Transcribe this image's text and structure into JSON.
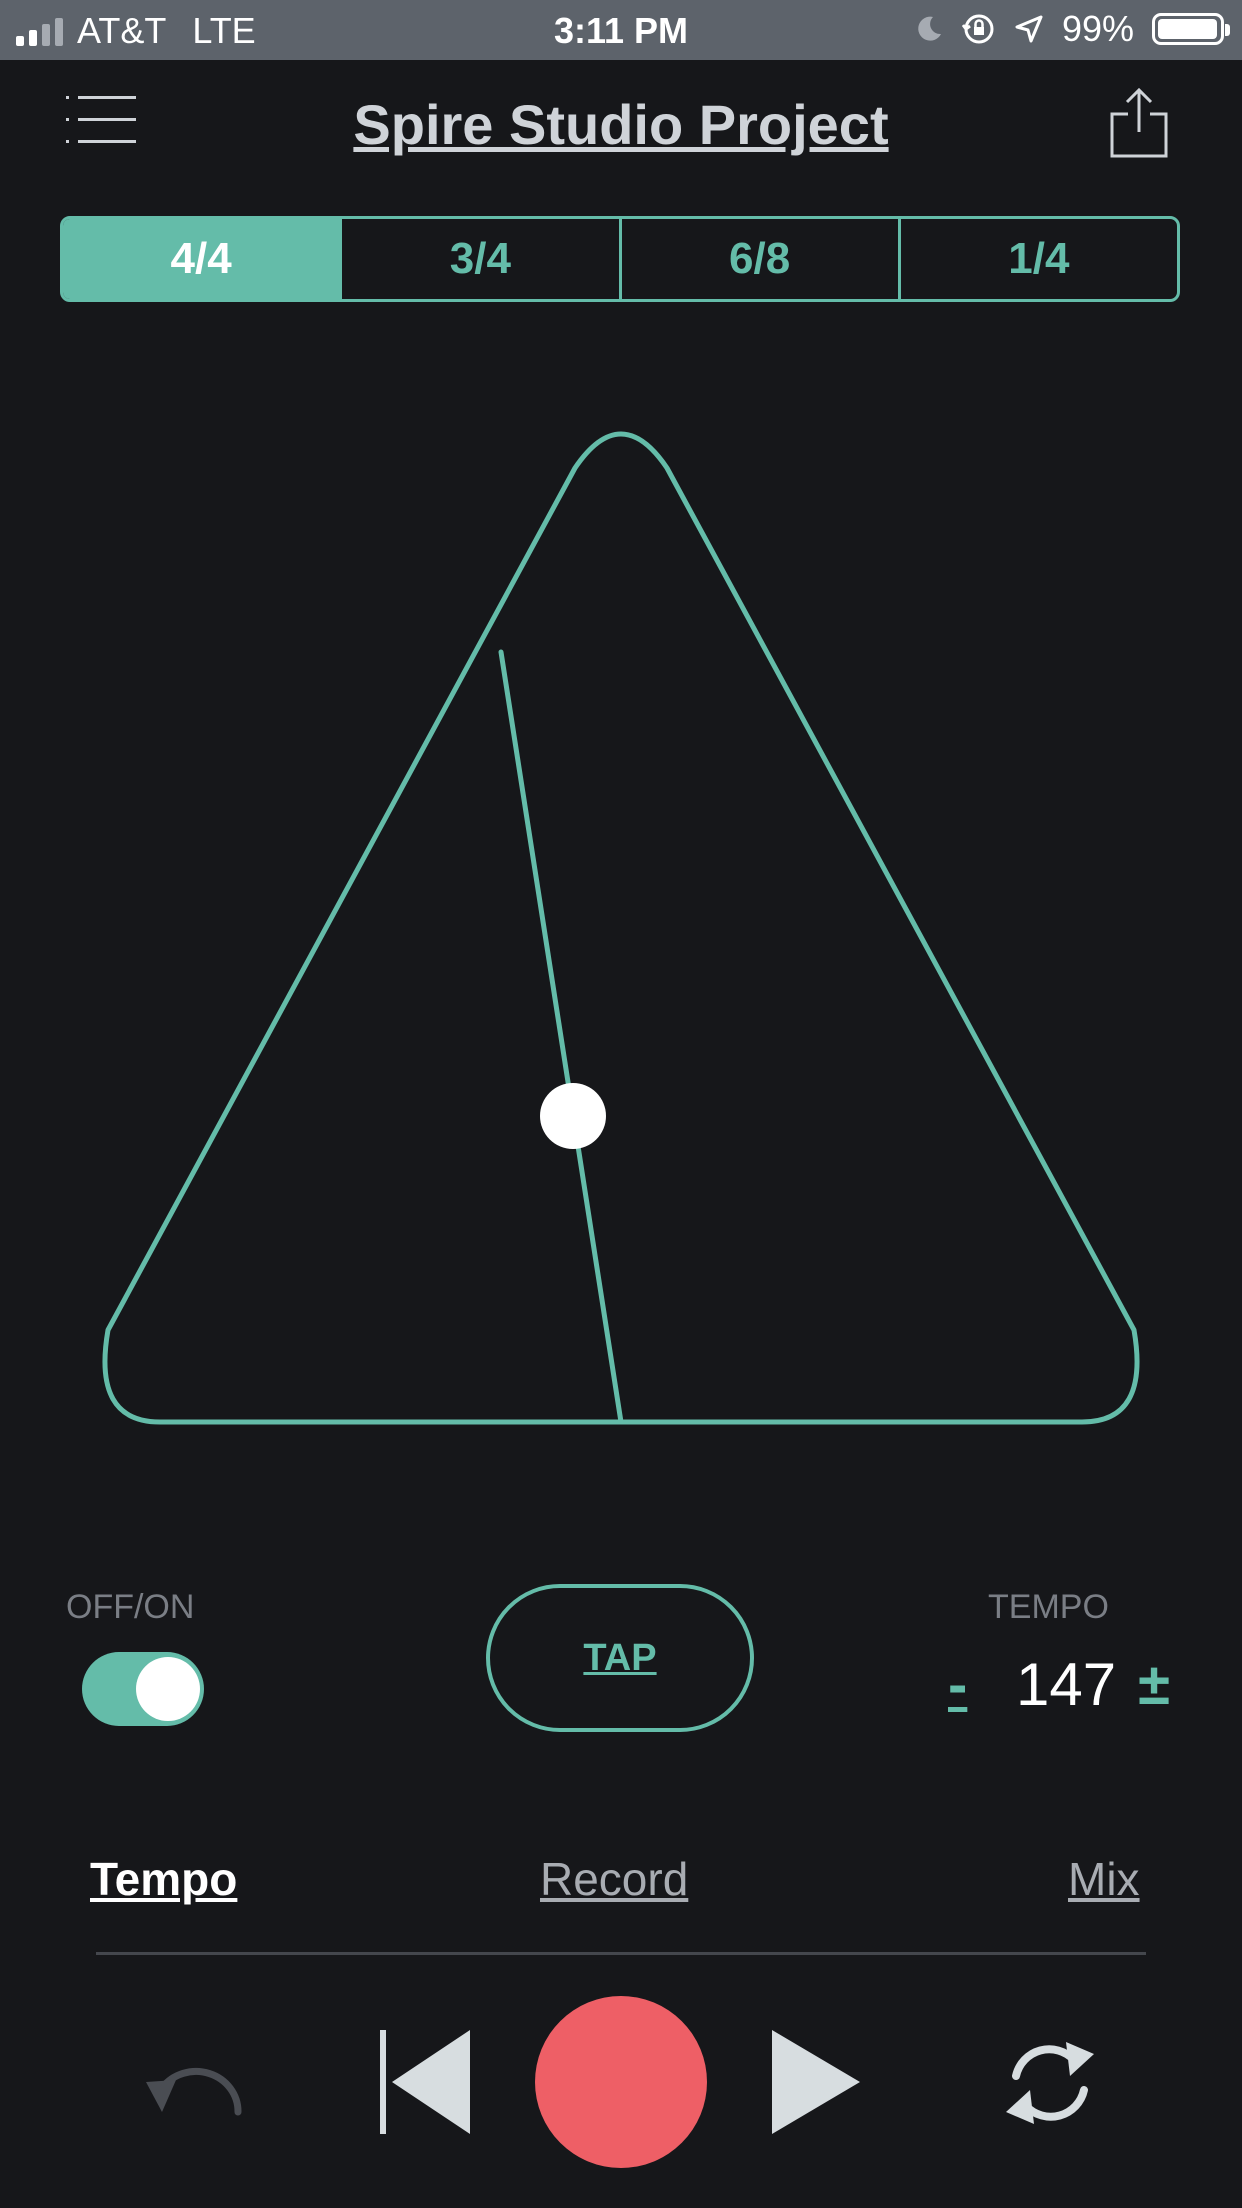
{
  "status_bar": {
    "carrier": "AT&T",
    "network": "LTE",
    "time": "3:11 PM",
    "battery": "99%",
    "battery_level": 0.99
  },
  "header": {
    "title": "Spire Studio Project",
    "menu_icon": "hamburger-menu-icon",
    "share_icon": "share-icon"
  },
  "time_signatures": [
    {
      "label": "4/4",
      "active": true
    },
    {
      "label": "3/4",
      "active": false
    },
    {
      "label": "6/8",
      "active": false
    },
    {
      "label": "1/4",
      "active": false
    }
  ],
  "metronome": {
    "icon": "metronome-icon",
    "color": "#64bca9"
  },
  "controls": {
    "offon_label": "OFF/ON",
    "toggle_on": true,
    "tap_label": "TAP",
    "tempo_label": "TEMPO",
    "tempo_minus": "-",
    "tempo_value": "147",
    "tempo_plus": "±"
  },
  "tabs": [
    {
      "label": "Tempo",
      "active": true
    },
    {
      "label": "Record",
      "active": false
    },
    {
      "label": "Mix",
      "active": false
    }
  ],
  "transport": {
    "undo_icon": "undo-icon",
    "prev_icon": "skip-back-icon",
    "record_icon": "record-icon",
    "play_icon": "play-icon",
    "loop_icon": "loop-icon",
    "record_color": "#ee5f66"
  },
  "colors": {
    "accent": "#64bca9",
    "background": "#16171a",
    "status_bar": "#5d636b"
  }
}
